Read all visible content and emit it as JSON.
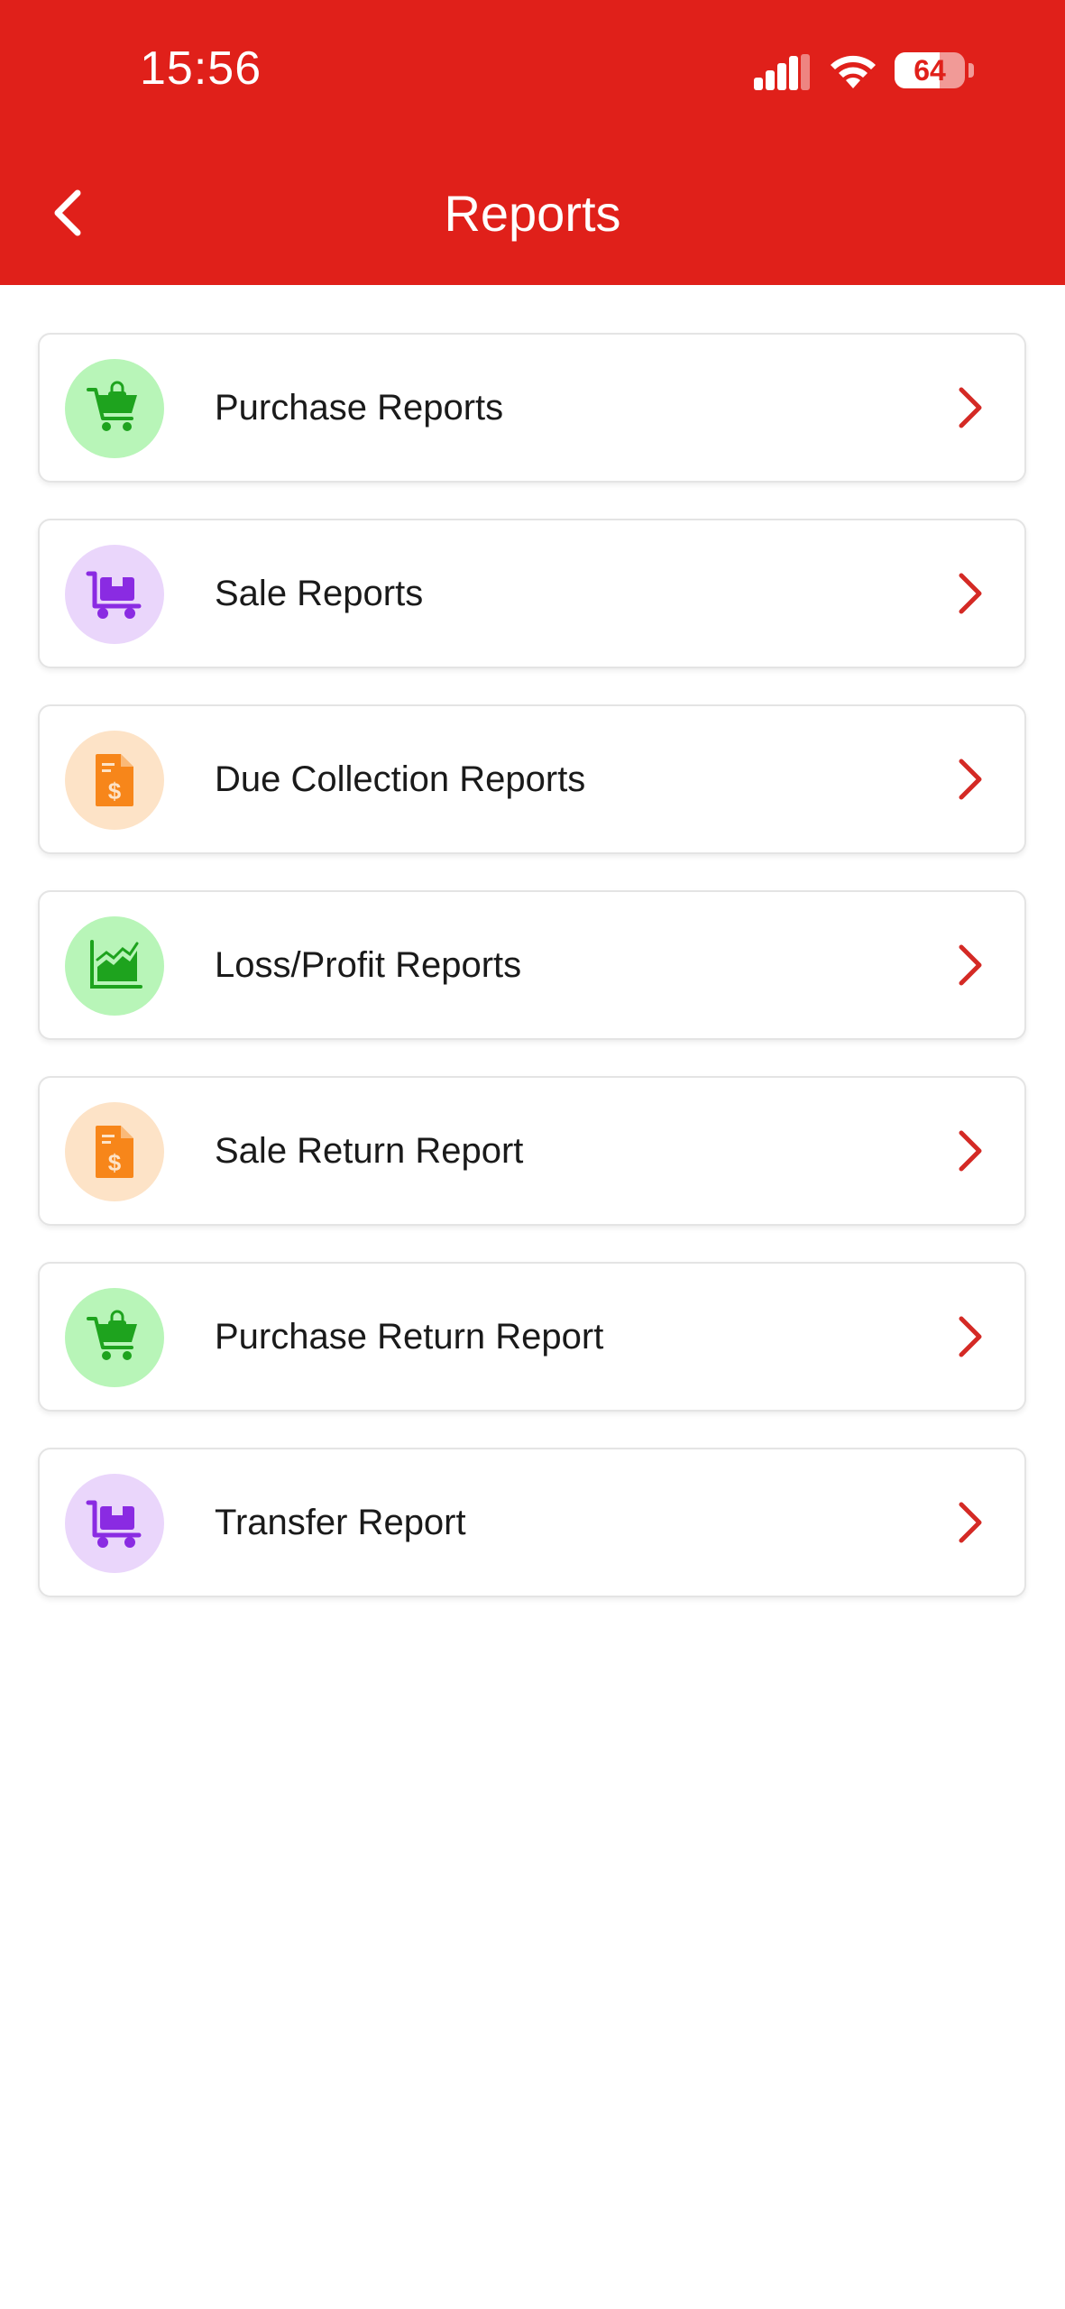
{
  "status_bar": {
    "time": "15:56",
    "battery_level": "64",
    "battery_fraction": 0.64
  },
  "header": {
    "title": "Reports"
  },
  "colors": {
    "header_bg": "#e0201a",
    "chevron": "#d42a25",
    "green_bg": "#b8f5b8",
    "green_fg": "#1ea31e",
    "purple_bg": "#ead6fb",
    "purple_fg": "#8a2be2",
    "orange_bg": "#fde3c7",
    "orange_fg": "#f7861a"
  },
  "reports": [
    {
      "label": "Purchase Reports",
      "icon": "shopping-cart-icon",
      "tone": "green"
    },
    {
      "label": "Sale Reports",
      "icon": "delivery-cart-icon",
      "tone": "purple"
    },
    {
      "label": "Due Collection Reports",
      "icon": "invoice-dollar-icon",
      "tone": "orange"
    },
    {
      "label": "Loss/Profit Reports",
      "icon": "area-chart-icon",
      "tone": "green"
    },
    {
      "label": "Sale Return Report",
      "icon": "invoice-dollar-icon",
      "tone": "orange"
    },
    {
      "label": "Purchase Return Report",
      "icon": "shopping-cart-icon",
      "tone": "green"
    },
    {
      "label": "Transfer Report",
      "icon": "delivery-cart-icon",
      "tone": "purple"
    }
  ]
}
